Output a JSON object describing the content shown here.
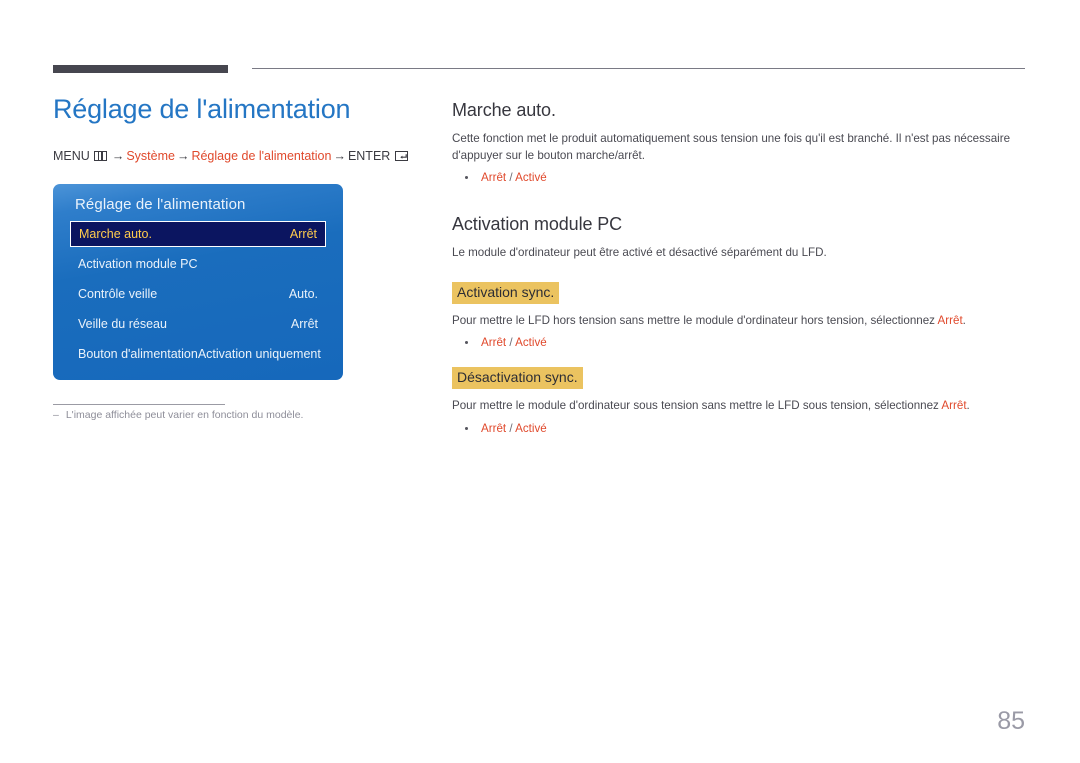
{
  "page": {
    "number": "85",
    "title": "Réglage de l'alimentation"
  },
  "breadcrumb": {
    "menu_label": "MENU",
    "menu_icon": "menu-grid-icon",
    "arrow": "→",
    "item1": "Système",
    "item2": "Réglage de l'alimentation",
    "enter_label": "ENTER",
    "enter_icon": "enter-return-icon"
  },
  "osd": {
    "title": "Réglage de l'alimentation",
    "rows": [
      {
        "label": "Marche auto.",
        "value": "Arrêt",
        "selected": true
      },
      {
        "label": "Activation module PC",
        "value": "",
        "selected": false
      },
      {
        "label": "Contrôle veille",
        "value": "Auto.",
        "selected": false
      },
      {
        "label": "Veille du réseau",
        "value": "Arrêt",
        "selected": false
      },
      {
        "label": "Bouton d'alimentation",
        "value": "Activation uniquement",
        "selected": false
      }
    ]
  },
  "note": {
    "dash": "–",
    "text": "L'image affichée peut varier en fonction du modèle."
  },
  "sections": {
    "marche_auto": {
      "heading": "Marche auto.",
      "paragraph": "Cette fonction met le produit automatiquement sous tension une fois qu'il est branché. Il n'est pas nécessaire d'appuyer sur le bouton marche/arrêt.",
      "option_off": "Arrêt",
      "option_sep": " / ",
      "option_on": "Activé"
    },
    "activation_module_pc": {
      "heading": "Activation module PC",
      "paragraph": "Le module d'ordinateur peut être activé et désactivé séparément du LFD."
    },
    "activation_sync": {
      "heading": "Activation sync.",
      "paragraph_pre": "Pour mettre le LFD hors tension sans mettre le module d'ordinateur hors tension, sélectionnez ",
      "paragraph_accent": "Arrêt",
      "paragraph_post": ".",
      "option_off": "Arrêt",
      "option_sep": " / ",
      "option_on": "Activé"
    },
    "desactivation_sync": {
      "heading": "Désactivation sync.",
      "paragraph_pre": "Pour mettre le module d'ordinateur sous tension sans mettre le LFD sous tension, sélectionnez ",
      "paragraph_accent": "Arrêt",
      "paragraph_post": ".",
      "option_off": "Arrêt",
      "option_sep": " / ",
      "option_on": "Activé"
    }
  },
  "colors": {
    "title_blue": "#2476c4",
    "accent_orange": "#e0492c",
    "highlight_gold": "#ebc360",
    "osd_blue": "#1668bb",
    "osd_selected_bg": "#0b1560",
    "osd_selected_text": "#ffcc4d",
    "rule_dark": "#46464f"
  }
}
